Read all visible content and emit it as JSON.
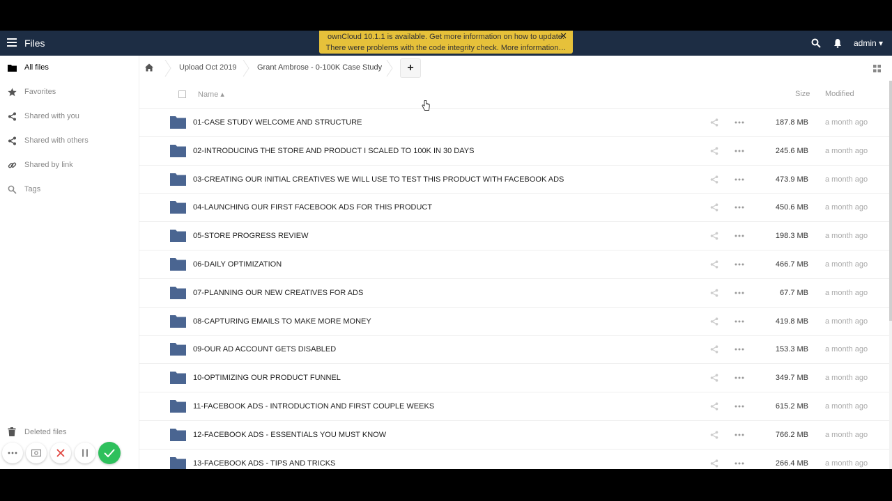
{
  "header": {
    "app_name": "Files",
    "notice_line1": "ownCloud 10.1.1 is available. Get more information on how to update.",
    "notice_line2": "There were problems with the code integrity check. More information…",
    "notice_close": "✕",
    "user": "admin ▾"
  },
  "sidebar": {
    "items": [
      {
        "label": "All files",
        "icon": "folder-icon"
      },
      {
        "label": "Favorites",
        "icon": "star-icon"
      },
      {
        "label": "Shared with you",
        "icon": "share-icon"
      },
      {
        "label": "Shared with others",
        "icon": "share-icon"
      },
      {
        "label": "Shared by link",
        "icon": "link-icon"
      },
      {
        "label": "Tags",
        "icon": "search-icon"
      }
    ],
    "deleted": "Deleted files"
  },
  "breadcrumb": {
    "items": [
      "Upload Oct 2019",
      "Grant Ambrose - 0-100K Case Study"
    ],
    "new_label": "+"
  },
  "columns": {
    "name": "Name ▴",
    "size": "Size",
    "modified": "Modified"
  },
  "files": [
    {
      "name": "01-CASE STUDY WELCOME AND STRUCTURE",
      "size": "187.8 MB",
      "modified": "a month ago"
    },
    {
      "name": "02-INTRODUCING THE STORE AND PRODUCT I SCALED TO 100K IN 30 DAYS",
      "size": "245.6 MB",
      "modified": "a month ago"
    },
    {
      "name": "03-CREATING OUR INITIAL CREATIVES WE WILL USE TO TEST THIS PRODUCT WITH FACEBOOK ADS",
      "size": "473.9 MB",
      "modified": "a month ago"
    },
    {
      "name": "04-LAUNCHING OUR FIRST FACEBOOK ADS FOR THIS PRODUCT",
      "size": "450.6 MB",
      "modified": "a month ago"
    },
    {
      "name": "05-STORE PROGRESS REVIEW",
      "size": "198.3 MB",
      "modified": "a month ago"
    },
    {
      "name": "06-DAILY OPTIMIZATION",
      "size": "466.7 MB",
      "modified": "a month ago"
    },
    {
      "name": "07-PLANNING OUR NEW CREATIVES FOR ADS",
      "size": "67.7 MB",
      "modified": "a month ago"
    },
    {
      "name": "08-CAPTURING EMAILS TO MAKE MORE MONEY",
      "size": "419.8 MB",
      "modified": "a month ago"
    },
    {
      "name": "09-OUR AD ACCOUNT GETS DISABLED",
      "size": "153.3 MB",
      "modified": "a month ago"
    },
    {
      "name": "10-OPTIMIZING OUR PRODUCT FUNNEL",
      "size": "349.7 MB",
      "modified": "a month ago"
    },
    {
      "name": "11-FACEBOOK ADS - INTRODUCTION AND FIRST COUPLE WEEKS",
      "size": "615.2 MB",
      "modified": "a month ago"
    },
    {
      "name": "12-FACEBOOK ADS - ESSENTIALS YOU MUST KNOW",
      "size": "766.2 MB",
      "modified": "a month ago"
    },
    {
      "name": "13-FACEBOOK ADS - TIPS AND TRICKS",
      "size": "266.4 MB",
      "modified": "a month ago"
    }
  ],
  "colors": {
    "header_bg": "#1d2d44",
    "folder": "#4a6591",
    "notice_bg": "#e6c13a",
    "confirm": "#2ec05c"
  }
}
